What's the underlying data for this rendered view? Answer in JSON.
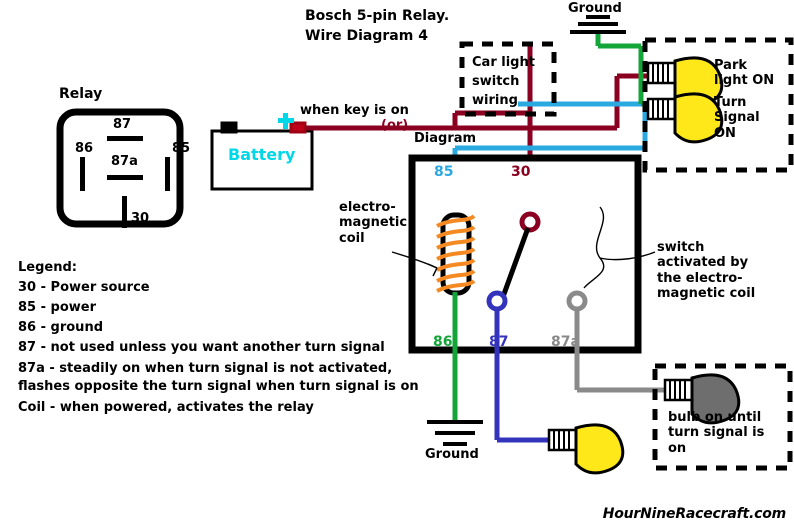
{
  "title": {
    "line1": "Bosch 5-pin Relay.",
    "line2": "Wire Diagram 4"
  },
  "relay_pinout": {
    "heading": "Relay",
    "pins": {
      "top": "87",
      "left": "86",
      "right": "85",
      "middle": "87a",
      "bottom": "30"
    }
  },
  "battery": {
    "label": "Battery",
    "plus": "+",
    "color": "#00d8e8"
  },
  "wire_notes": {
    "key_on": "when key is on",
    "or": "(or)",
    "diagram": "Diagram"
  },
  "switch_box": {
    "line1": "Car light",
    "line2": "switch",
    "line3": "wiring"
  },
  "ground_top": "Ground",
  "ground_bottom": "Ground",
  "bulbs_top": {
    "park": "Park\nlight ON",
    "turn": "Turn\nSignal\nON"
  },
  "bulb_bottom_note": "bulb on until\nturn signal is\non",
  "annotations": {
    "coil": "electro-\nmagnetic\ncoil",
    "switch": "switch\nactivated by\nthe electro-\nmagnetic coil"
  },
  "terminals": {
    "t85": "85",
    "t30": "30",
    "t86": "86",
    "t87": "87",
    "t87a": "87a"
  },
  "colors": {
    "c85": "#29a9e0",
    "c30": "#8b0020",
    "c86": "#13a538",
    "c87": "#3333bb",
    "c87a": "#8a8a8a",
    "coil": "#f58a22",
    "bulb_on": "#ffe81a",
    "bulb_off": "#6e6e6e"
  },
  "legend": {
    "heading": "Legend:",
    "items": [
      "30 - Power source",
      "85 - power",
      "86 - ground",
      "87 - not used unless you want another turn signal",
      "87a - steadily on when turn signal is not activated,",
      "flashes opposite the turn signal when turn signal is on",
      "Coil - when powered, activates the relay"
    ]
  },
  "watermark": "HourNineRacecraft.com"
}
